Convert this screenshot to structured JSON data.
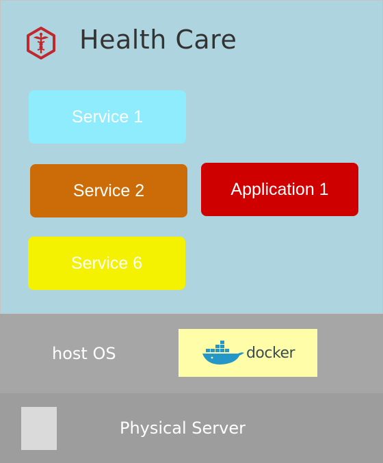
{
  "header": {
    "title": "Health Care",
    "logo_icon": "caduceus-hexagon-icon"
  },
  "services": {
    "service_1": {
      "label": "Service 1",
      "color": "#8eecfd"
    },
    "service_2": {
      "label": "Service 2",
      "color": "#cc6c08"
    },
    "application_1": {
      "label": "Application 1",
      "color": "#cf0000"
    },
    "service_6": {
      "label": "Service 6",
      "color": "#f4f200"
    }
  },
  "host_layer": {
    "label": "host OS",
    "runtime": "docker",
    "runtime_icon": "docker-whale-icon"
  },
  "server_layer": {
    "label": "Physical Server",
    "icon": "server-block-icon"
  },
  "colors": {
    "app_layer_bg": "#aed5df",
    "host_layer_bg": "#a6a6a6",
    "server_layer_bg": "#9d9d9d",
    "docker_bg": "#fffda8",
    "logo_red": "#c0282d"
  }
}
